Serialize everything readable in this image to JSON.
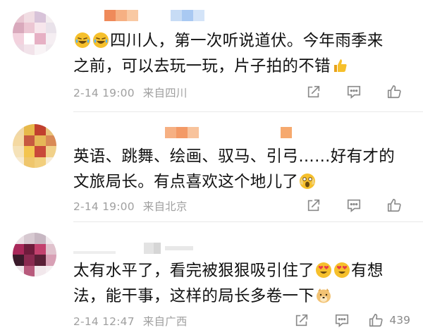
{
  "comments": [
    {
      "lines": [
        "四川人，第一次听说道伏。今年雨季来",
        "之前，可以去玩一玩，片子拍的不错"
      ],
      "time": "2-14 19:00",
      "source": "来自四川",
      "likes": ""
    },
    {
      "lines": [
        "英语、跳舞、绘画、驭马、引弓……好有才的",
        "文旅局长。有点喜欢这个地儿了"
      ],
      "time": "2-14 19:00",
      "source": "来自北京",
      "likes": ""
    },
    {
      "lines": [
        "太有水平了，看完被狠狠吸引住了",
        "有想",
        "法，能干事，这样的局长多卷一下"
      ],
      "time": "2-14 12:47",
      "source": "来自广西",
      "likes": "439"
    }
  ],
  "icons": {
    "emoji_laugh": "laughing-tears-emoji",
    "emoji_thumb": "thumbs-up-emoji",
    "emoji_shock": "screaming-face-emoji",
    "emoji_heart_eyes": "heart-eyes-emoji",
    "emoji_doge": "doge-emoji",
    "share": "share-icon",
    "comment": "comment-icon",
    "like": "like-icon"
  },
  "colors": {
    "text": "#111111",
    "meta": "#a0a0a0",
    "icon": "#8a8a8a",
    "emoji_yellow": "#f6c02c",
    "username_orange": "#f5a060",
    "username_blue": "#9fc4f2"
  }
}
